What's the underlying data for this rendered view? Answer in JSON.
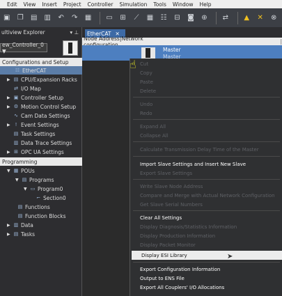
{
  "menubar": [
    "Edit",
    "View",
    "Insert",
    "Project",
    "Controller",
    "Simulation",
    "Tools",
    "Window",
    "Help"
  ],
  "toolbar_icons": [
    "save-icon",
    "copy-icon",
    "paste-icon",
    "delete-icon",
    "undo-icon",
    "redo-icon",
    "build-icon",
    "window-icon",
    "layout-icon",
    "tool-icon",
    "grid-icon",
    "list-icon",
    "table-icon",
    "binoculars-icon",
    "network-icon",
    "sync-icon",
    "warning-icon",
    "tool2-icon",
    "tool3-icon"
  ],
  "left_panel": {
    "title": "ultiview Explorer",
    "controller": "ew_Controller_0 ▼",
    "sections": {
      "config": "Configurations and Setup",
      "programming": "Programming"
    },
    "config_items": [
      "EtherCAT",
      "CPU/Expansion Racks",
      "I/O Map",
      "Controller Setup",
      "Motion Control Setup",
      "Cam Data Settings",
      "Event Settings",
      "Task Settings",
      "Data Trace Settings",
      "OPC UA Settings"
    ],
    "prog_items": [
      "POUs",
      "Programs",
      "Program0",
      "Section0",
      "Functions",
      "Function Blocks",
      "Data",
      "Tasks"
    ]
  },
  "tab": {
    "label": "EtherCAT",
    "close": "✕"
  },
  "network": {
    "header_left": "Node Address|Network configuration",
    "header_div": "|",
    "master": "Master",
    "master_sub": "Master"
  },
  "context_menu": [
    {
      "label": "Cut",
      "enabled": false
    },
    {
      "label": "Copy",
      "enabled": false
    },
    {
      "label": "Paste",
      "enabled": false
    },
    {
      "label": "Delete",
      "enabled": false
    },
    {
      "label": "Undo",
      "enabled": false
    },
    {
      "label": "Redo",
      "enabled": false
    },
    {
      "label": "Expand All",
      "enabled": false
    },
    {
      "label": "Collapse All",
      "enabled": false
    },
    {
      "label": "Calculate Transmission Delay Time of the Master",
      "enabled": false
    },
    {
      "label": "Import Slave Settings and Insert New Slave",
      "enabled": true
    },
    {
      "label": "Export Slave Settings",
      "enabled": false
    },
    {
      "label": "Write Slave Node Address",
      "enabled": false
    },
    {
      "label": "Compare and Merge with Actual Network Configuration",
      "enabled": false
    },
    {
      "label": "Get Slave Serial Numbers",
      "enabled": false
    },
    {
      "label": "Clear All Settings",
      "enabled": true
    },
    {
      "label": "Display Diagnosis/Statistics Information",
      "enabled": false
    },
    {
      "label": "Display Production Information",
      "enabled": false
    },
    {
      "label": "Display Packet Monitor",
      "enabled": false
    },
    {
      "label": "Display ESI Library",
      "enabled": true,
      "highlighted": true
    },
    {
      "label": "Export Configuration Information",
      "enabled": true
    },
    {
      "label": "Output to ENS File",
      "enabled": true
    },
    {
      "label": "Export All Couplers' I/O Allocations",
      "enabled": true
    }
  ]
}
